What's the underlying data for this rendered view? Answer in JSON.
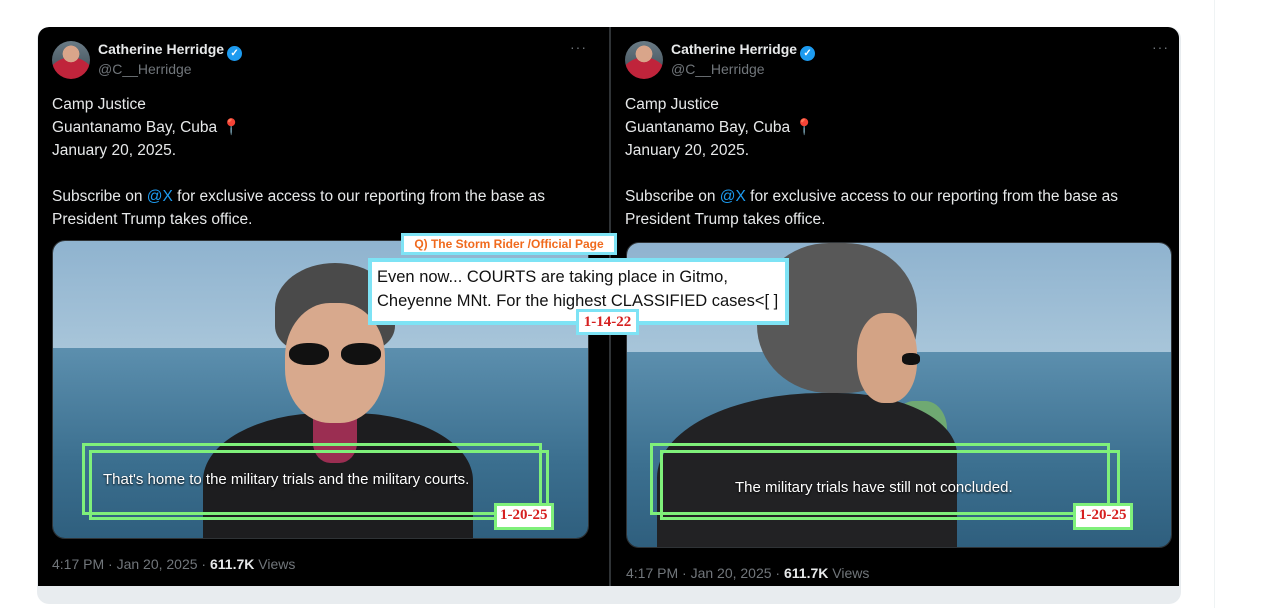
{
  "tweets": [
    {
      "author": {
        "name": "Catherine Herridge",
        "handle": "@C__Herridge"
      },
      "more": "···",
      "lines": [
        "Camp Justice",
        "Guantanamo Bay, Cuba",
        "January 20, 2025."
      ],
      "pin": "📍",
      "subscribe": {
        "before": "Subscribe on ",
        "mention": "@X",
        "after": " for exclusive access to our reporting from the base as President Trump takes office."
      },
      "caption": "That's home to the military trials and the military courts.",
      "annotation_date": "1-20-25",
      "timestamp": "4:17 PM · Jan 20, 2025 · ",
      "views_count": "611.7K",
      "views_label": " Views"
    },
    {
      "author": {
        "name": "Catherine Herridge",
        "handle": "@C__Herridge"
      },
      "more": "···",
      "lines": [
        "Camp Justice",
        "Guantanamo Bay, Cuba",
        "January 20, 2025."
      ],
      "pin": "📍",
      "subscribe": {
        "before": "Subscribe on ",
        "mention": "@X",
        "after": " for exclusive access to our reporting from the base as President Trump takes office."
      },
      "caption": "The military trials have still not concluded.",
      "annotation_date": "1-20-25",
      "timestamp": "4:17 PM · Jan 20, 2025 · ",
      "views_count": "611.7K",
      "views_label": " Views"
    }
  ],
  "q_overlay": {
    "source": "Q) The Storm Rider /Official Page",
    "quote": "Even now... COURTS are taking place in Gitmo, Cheyenne MNt. For the highest CLASSIFIED cases<[ ]",
    "date": "1-14-22"
  },
  "colors": {
    "accent": "#1d9bf0",
    "annotation_green": "#7ff07a",
    "annotation_cyan": "#7ee3f5",
    "annotation_red": "#d62020"
  }
}
